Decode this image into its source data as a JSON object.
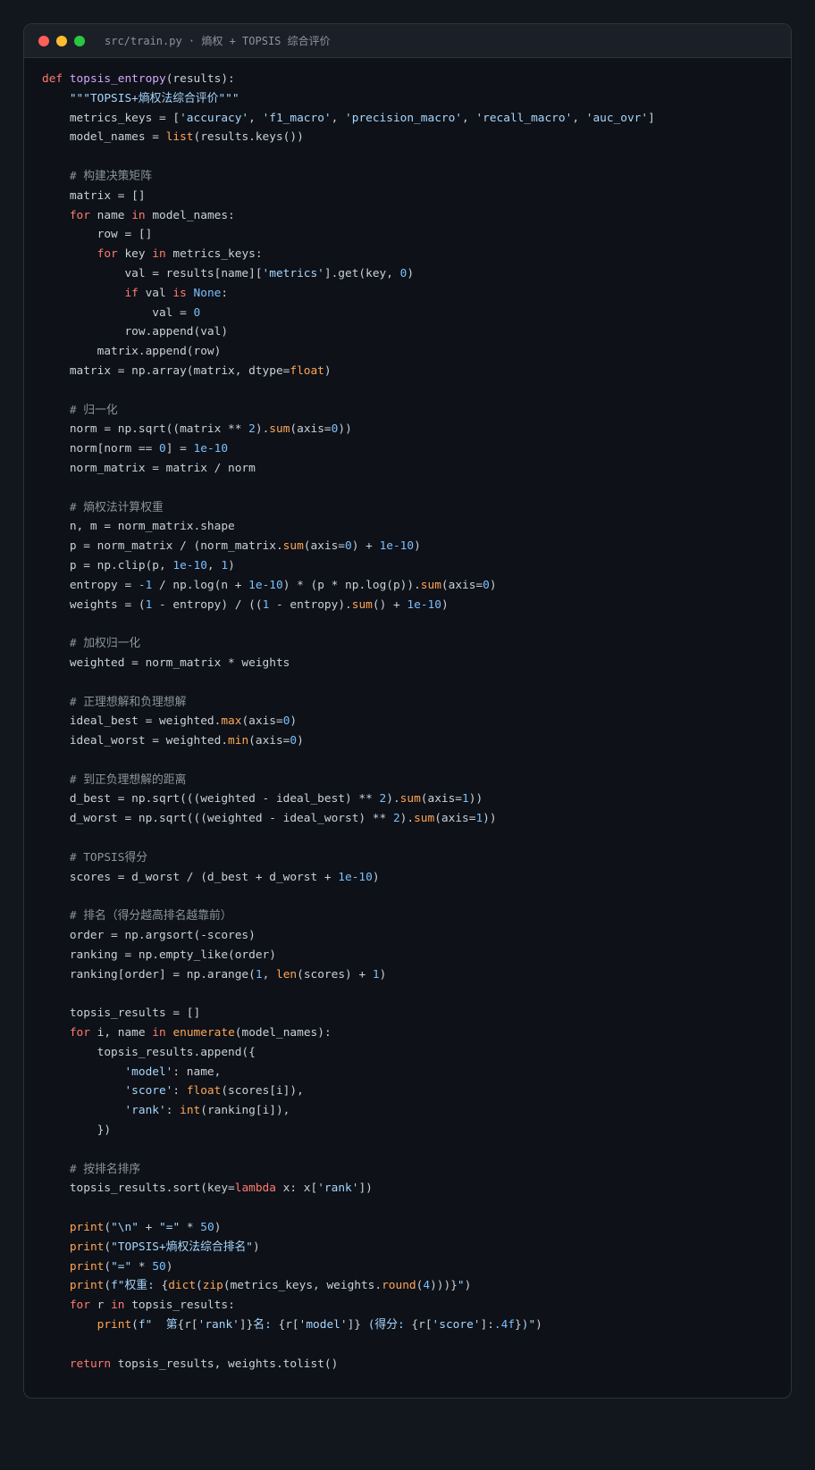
{
  "window": {
    "title": "src/train.py · 熵权 + TOPSIS 综合评价",
    "traffic_lights": [
      "#ff5f57",
      "#febc2e",
      "#28c840"
    ]
  },
  "syntax_colors": {
    "keyword": "#ff7b72",
    "function": "#d2a8ff",
    "string": "#a5d6ff",
    "number": "#79c0ff",
    "comment": "#8b949e",
    "builtin": "#ffa657",
    "text": "#c9d1d9"
  },
  "code_lines": [
    [
      [
        "kw",
        "def "
      ],
      [
        "fn",
        "topsis_entropy"
      ],
      [
        "",
        "(results):"
      ]
    ],
    [
      [
        "",
        "    "
      ],
      [
        "str",
        "\"\"\"TOPSIS+熵权法综合评价\"\"\""
      ]
    ],
    [
      [
        "",
        "    metrics_keys = ["
      ],
      [
        "str",
        "'accuracy'"
      ],
      [
        "",
        ", "
      ],
      [
        "str",
        "'f1_macro'"
      ],
      [
        "",
        ", "
      ],
      [
        "str",
        "'precision_macro'"
      ],
      [
        "",
        ", "
      ],
      [
        "str",
        "'recall_macro'"
      ],
      [
        "",
        ", "
      ],
      [
        "str",
        "'auc_ovr'"
      ],
      [
        "",
        "]"
      ]
    ],
    [
      [
        "",
        "    model_names = "
      ],
      [
        "bi",
        "list"
      ],
      [
        "",
        "(results.keys())"
      ]
    ],
    [],
    [
      [
        "cm",
        "    # 构建决策矩阵"
      ]
    ],
    [
      [
        "",
        "    matrix = []"
      ]
    ],
    [
      [
        "",
        "    "
      ],
      [
        "kw",
        "for"
      ],
      [
        "",
        " name "
      ],
      [
        "kw",
        "in"
      ],
      [
        "",
        " model_names:"
      ]
    ],
    [
      [
        "",
        "        row = []"
      ]
    ],
    [
      [
        "",
        "        "
      ],
      [
        "kw",
        "for"
      ],
      [
        "",
        " key "
      ],
      [
        "kw",
        "in"
      ],
      [
        "",
        " metrics_keys:"
      ]
    ],
    [
      [
        "",
        "            val = results[name]["
      ],
      [
        "str",
        "'metrics'"
      ],
      [
        "",
        "].get(key, "
      ],
      [
        "num",
        "0"
      ],
      [
        "",
        ")"
      ]
    ],
    [
      [
        "",
        "            "
      ],
      [
        "kw",
        "if"
      ],
      [
        "",
        " val "
      ],
      [
        "kw",
        "is"
      ],
      [
        "",
        " "
      ],
      [
        "num",
        "None"
      ],
      [
        "",
        ":"
      ]
    ],
    [
      [
        "",
        "                val = "
      ],
      [
        "num",
        "0"
      ]
    ],
    [
      [
        "",
        "            row.append(val)"
      ]
    ],
    [
      [
        "",
        "        matrix.append(row)"
      ]
    ],
    [
      [
        "",
        "    matrix = np.array(matrix, dtype="
      ],
      [
        "bi",
        "float"
      ],
      [
        "",
        ")"
      ]
    ],
    [],
    [
      [
        "cm",
        "    # 归一化"
      ]
    ],
    [
      [
        "",
        "    norm = np.sqrt((matrix ** "
      ],
      [
        "num",
        "2"
      ],
      [
        "",
        ")."
      ],
      [
        "bi",
        "sum"
      ],
      [
        "",
        "(axis="
      ],
      [
        "num",
        "0"
      ],
      [
        "",
        "))"
      ]
    ],
    [
      [
        "",
        "    norm[norm == "
      ],
      [
        "num",
        "0"
      ],
      [
        "",
        "] = "
      ],
      [
        "num",
        "1e-10"
      ]
    ],
    [
      [
        "",
        "    norm_matrix = matrix / norm"
      ]
    ],
    [],
    [
      [
        "cm",
        "    # 熵权法计算权重"
      ]
    ],
    [
      [
        "",
        "    n, m = norm_matrix.shape"
      ]
    ],
    [
      [
        "",
        "    p = norm_matrix / (norm_matrix."
      ],
      [
        "bi",
        "sum"
      ],
      [
        "",
        "(axis="
      ],
      [
        "num",
        "0"
      ],
      [
        "",
        ") + "
      ],
      [
        "num",
        "1e-10"
      ],
      [
        "",
        ")"
      ]
    ],
    [
      [
        "",
        "    p = np.clip(p, "
      ],
      [
        "num",
        "1e-10"
      ],
      [
        "",
        ", "
      ],
      [
        "num",
        "1"
      ],
      [
        "",
        ")"
      ]
    ],
    [
      [
        "",
        "    entropy = "
      ],
      [
        "num",
        "-1"
      ],
      [
        "",
        " / np.log(n + "
      ],
      [
        "num",
        "1e-10"
      ],
      [
        "",
        ") * (p * np.log(p))."
      ],
      [
        "bi",
        "sum"
      ],
      [
        "",
        "(axis="
      ],
      [
        "num",
        "0"
      ],
      [
        "",
        ")"
      ]
    ],
    [
      [
        "",
        "    weights = ("
      ],
      [
        "num",
        "1"
      ],
      [
        "",
        " - entropy) / (("
      ],
      [
        "num",
        "1"
      ],
      [
        "",
        " - entropy)."
      ],
      [
        "bi",
        "sum"
      ],
      [
        "",
        "() + "
      ],
      [
        "num",
        "1e-10"
      ],
      [
        "",
        ")"
      ]
    ],
    [],
    [
      [
        "cm",
        "    # 加权归一化"
      ]
    ],
    [
      [
        "",
        "    weighted = norm_matrix * weights"
      ]
    ],
    [],
    [
      [
        "cm",
        "    # 正理想解和负理想解"
      ]
    ],
    [
      [
        "",
        "    ideal_best = weighted."
      ],
      [
        "bi",
        "max"
      ],
      [
        "",
        "(axis="
      ],
      [
        "num",
        "0"
      ],
      [
        "",
        ")"
      ]
    ],
    [
      [
        "",
        "    ideal_worst = weighted."
      ],
      [
        "bi",
        "min"
      ],
      [
        "",
        "(axis="
      ],
      [
        "num",
        "0"
      ],
      [
        "",
        ")"
      ]
    ],
    [],
    [
      [
        "cm",
        "    # 到正负理想解的距离"
      ]
    ],
    [
      [
        "",
        "    d_best = np.sqrt(((weighted - ideal_best) ** "
      ],
      [
        "num",
        "2"
      ],
      [
        "",
        ")."
      ],
      [
        "bi",
        "sum"
      ],
      [
        "",
        "(axis="
      ],
      [
        "num",
        "1"
      ],
      [
        "",
        "))"
      ]
    ],
    [
      [
        "",
        "    d_worst = np.sqrt(((weighted - ideal_worst) ** "
      ],
      [
        "num",
        "2"
      ],
      [
        "",
        ")."
      ],
      [
        "bi",
        "sum"
      ],
      [
        "",
        "(axis="
      ],
      [
        "num",
        "1"
      ],
      [
        "",
        "))"
      ]
    ],
    [],
    [
      [
        "cm",
        "    # TOPSIS得分"
      ]
    ],
    [
      [
        "",
        "    scores = d_worst / (d_best + d_worst + "
      ],
      [
        "num",
        "1e-10"
      ],
      [
        "",
        ")"
      ]
    ],
    [],
    [
      [
        "cm",
        "    # 排名（得分越高排名越靠前）"
      ]
    ],
    [
      [
        "",
        "    order = np.argsort(-scores)"
      ]
    ],
    [
      [
        "",
        "    ranking = np.empty_like(order)"
      ]
    ],
    [
      [
        "",
        "    ranking[order] = np.arange("
      ],
      [
        "num",
        "1"
      ],
      [
        "",
        ", "
      ],
      [
        "bi",
        "len"
      ],
      [
        "",
        "(scores) + "
      ],
      [
        "num",
        "1"
      ],
      [
        "",
        ")"
      ]
    ],
    [],
    [
      [
        "",
        "    topsis_results = []"
      ]
    ],
    [
      [
        "",
        "    "
      ],
      [
        "kw",
        "for"
      ],
      [
        "",
        " i, name "
      ],
      [
        "kw",
        "in"
      ],
      [
        "",
        " "
      ],
      [
        "bi",
        "enumerate"
      ],
      [
        "",
        "(model_names):"
      ]
    ],
    [
      [
        "",
        "        topsis_results.append({"
      ]
    ],
    [
      [
        "",
        "            "
      ],
      [
        "str",
        "'model'"
      ],
      [
        "",
        ": name,"
      ]
    ],
    [
      [
        "",
        "            "
      ],
      [
        "str",
        "'score'"
      ],
      [
        "",
        ": "
      ],
      [
        "bi",
        "float"
      ],
      [
        "",
        "(scores[i]),"
      ]
    ],
    [
      [
        "",
        "            "
      ],
      [
        "str",
        "'rank'"
      ],
      [
        "",
        ": "
      ],
      [
        "bi",
        "int"
      ],
      [
        "",
        "(ranking[i]),"
      ]
    ],
    [
      [
        "",
        "        })"
      ]
    ],
    [],
    [
      [
        "cm",
        "    # 按排名排序"
      ]
    ],
    [
      [
        "",
        "    topsis_results.sort(key="
      ],
      [
        "kw",
        "lambda"
      ],
      [
        "",
        " x: x["
      ],
      [
        "str",
        "'rank'"
      ],
      [
        "",
        "])"
      ]
    ],
    [],
    [
      [
        "",
        "    "
      ],
      [
        "bi",
        "print"
      ],
      [
        "",
        "("
      ],
      [
        "str",
        "\"\\n\""
      ],
      [
        "",
        " + "
      ],
      [
        "str",
        "\"=\""
      ],
      [
        "",
        " * "
      ],
      [
        "num",
        "50"
      ],
      [
        "",
        ")"
      ]
    ],
    [
      [
        "",
        "    "
      ],
      [
        "bi",
        "print"
      ],
      [
        "",
        "("
      ],
      [
        "str",
        "\"TOPSIS+熵权法综合排名\""
      ],
      [
        "",
        ")"
      ]
    ],
    [
      [
        "",
        "    "
      ],
      [
        "bi",
        "print"
      ],
      [
        "",
        "("
      ],
      [
        "str",
        "\"=\""
      ],
      [
        "",
        " * "
      ],
      [
        "num",
        "50"
      ],
      [
        "",
        ")"
      ]
    ],
    [
      [
        "",
        "    "
      ],
      [
        "bi",
        "print"
      ],
      [
        "",
        "("
      ],
      [
        "str",
        "f\"权重: "
      ],
      [
        "",
        "{"
      ],
      [
        "bi",
        "dict"
      ],
      [
        "",
        "("
      ],
      [
        "bi",
        "zip"
      ],
      [
        "",
        "(metrics_keys, weights."
      ],
      [
        "bi",
        "round"
      ],
      [
        "",
        "("
      ],
      [
        "num",
        "4"
      ],
      [
        "",
        ")))}"
      ],
      [
        "str",
        "\""
      ],
      [
        "",
        ")"
      ]
    ],
    [
      [
        "",
        "    "
      ],
      [
        "kw",
        "for"
      ],
      [
        "",
        " r "
      ],
      [
        "kw",
        "in"
      ],
      [
        "",
        " topsis_results:"
      ]
    ],
    [
      [
        "",
        "        "
      ],
      [
        "bi",
        "print"
      ],
      [
        "",
        "("
      ],
      [
        "str",
        "f\"  第"
      ],
      [
        "",
        "{r["
      ],
      [
        "str",
        "'rank'"
      ],
      [
        "",
        "]}"
      ],
      [
        "str",
        "名: "
      ],
      [
        "",
        "{r["
      ],
      [
        "str",
        "'model'"
      ],
      [
        "",
        "]}"
      ],
      [
        "str",
        " (得分: "
      ],
      [
        "",
        "{r["
      ],
      [
        "str",
        "'score'"
      ],
      [
        "",
        "]:"
      ],
      [
        "num",
        ".4f"
      ],
      [
        "",
        "}"
      ],
      [
        "str",
        ")\""
      ],
      [
        "",
        ")"
      ]
    ],
    [],
    [
      [
        "",
        "    "
      ],
      [
        "kw",
        "return"
      ],
      [
        "",
        " topsis_results, weights.tolist()"
      ]
    ]
  ]
}
